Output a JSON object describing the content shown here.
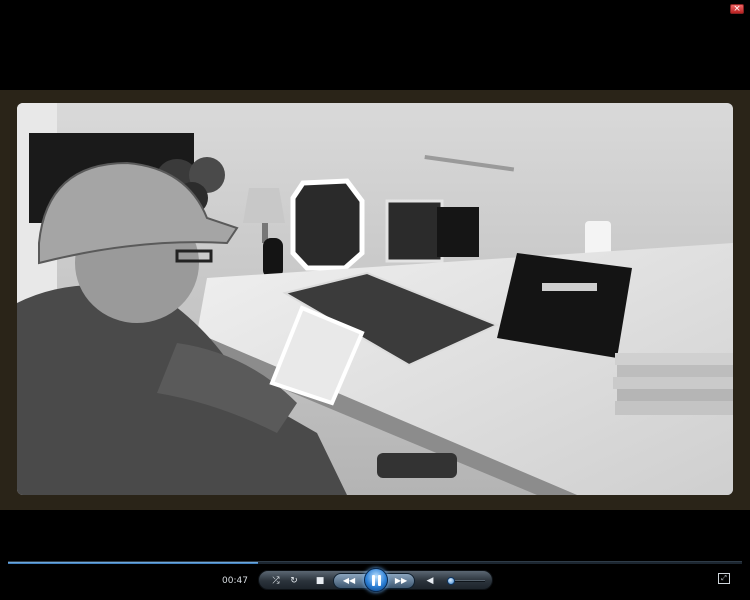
{
  "window": {
    "close_glyph": "×",
    "close_icon": "close-icon"
  },
  "video": {
    "frame_description_colors": {
      "frame": "#2a2418",
      "vignette": "#6b6b6b"
    }
  },
  "player": {
    "elapsed_time": "00:47",
    "progress_fraction": 0.34,
    "volume_fraction": 0.1,
    "accent_color": "#2b7fd6",
    "icons": {
      "shuffle": "shuffle-icon",
      "repeat": "repeat-icon",
      "stop": "stop-icon",
      "previous": "rewind-icon",
      "play_pause": "pause-icon",
      "next": "fast-forward-icon",
      "mute": "speaker-icon",
      "fullscreen": "fullscreen-icon"
    },
    "glyphs": {
      "shuffle": "⤮",
      "repeat": "↻",
      "stop": "■",
      "previous": "◀◀",
      "next": "▶▶",
      "mute": "◀",
      "fullscreen": "⤢"
    }
  }
}
